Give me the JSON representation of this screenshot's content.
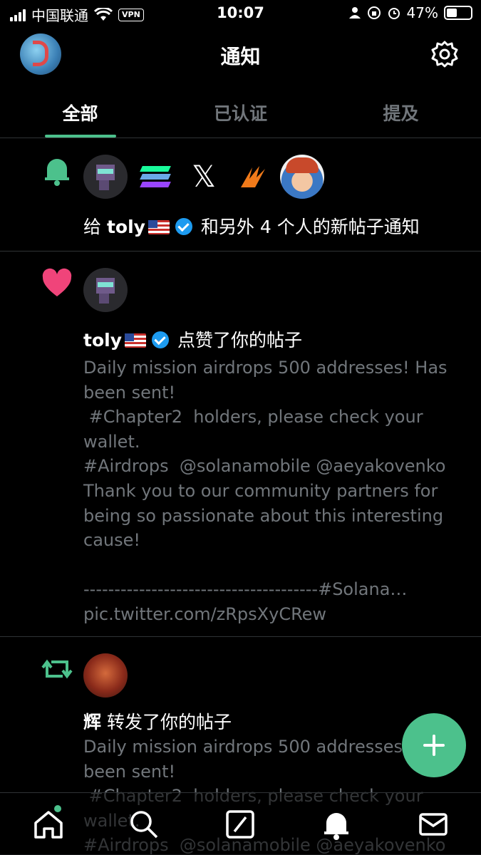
{
  "status_bar": {
    "carrier": "中国联通",
    "vpn": "VPN",
    "time": "10:07",
    "battery": "47%"
  },
  "header": {
    "title": "通知",
    "settings_icon": "gear-icon"
  },
  "tabs": [
    {
      "label": "全部",
      "active": true
    },
    {
      "label": "已认证",
      "active": false
    },
    {
      "label": "提及",
      "active": false
    }
  ],
  "notifications": [
    {
      "type": "bell",
      "prefix": "给 ",
      "user": "toly",
      "suffix": " 和另外 4 个人的新帖子通知"
    },
    {
      "type": "like",
      "user": "toly",
      "action": " 点赞了你的帖子",
      "text": "Daily mission airdrops 500 addresses! Has been sent!\n #Chapter2  holders, please check your wallet.\n#Airdrops  @solanamobile @aeyakovenko\nThank you to our community partners for being so passionate about this interesting cause!\n\n--------------------------------------#Solana…\npic.twitter.com/zRpsXyCRew"
    },
    {
      "type": "retweet",
      "user": "辉",
      "action": " 转发了你的帖子",
      "text": "Daily mission airdrops 500 addresses! Has been sent!\n #Chapter2  holders, please check your wallet.\n#Airdrops  @solanamobile @aeyakovenko"
    }
  ],
  "colors": {
    "accent": "#4cc18c",
    "like": "#f0447a",
    "verified": "#1d9bf0",
    "muted": "#71767b"
  },
  "bottom_nav": [
    "home-icon",
    "search-icon",
    "compose-icon",
    "bell-icon",
    "mail-icon"
  ]
}
